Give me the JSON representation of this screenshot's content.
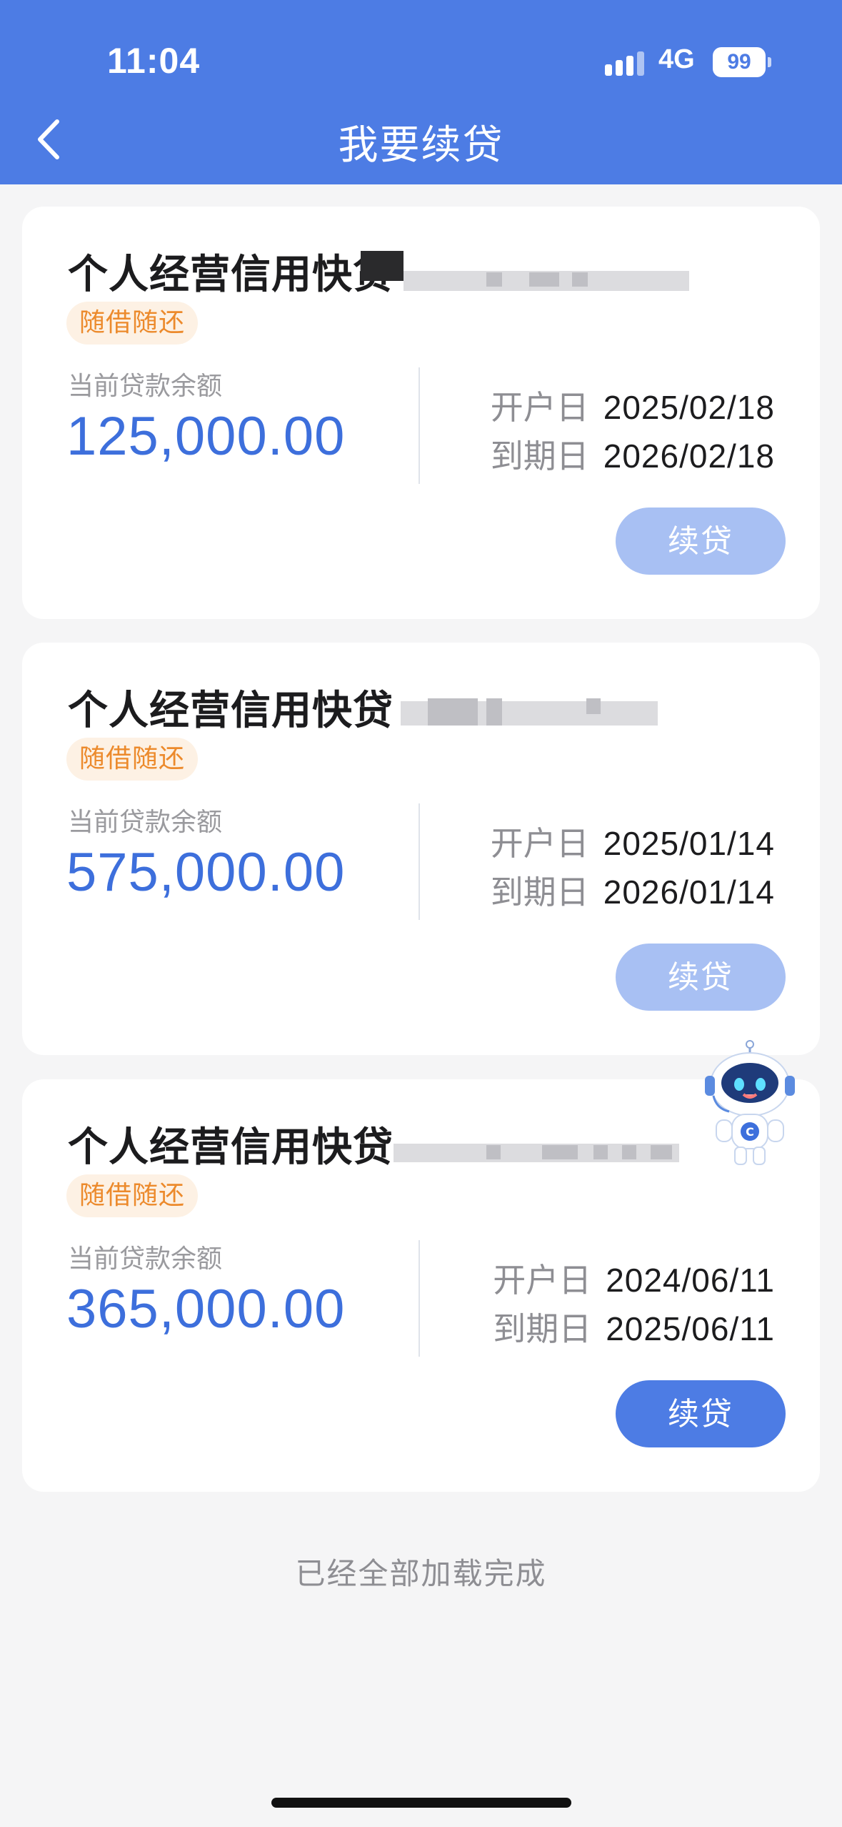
{
  "status_bar": {
    "time": "11:04",
    "network": "4G",
    "battery": "99"
  },
  "header": {
    "title": "我要续贷",
    "back_icon": "chevron-left-icon"
  },
  "loans": [
    {
      "title": "个人经营信用快贷",
      "tag": "随借随还",
      "balance_label": "当前贷款余额",
      "balance": "125,000.00",
      "open_label": "开户日",
      "open_date": "2025/02/18",
      "due_label": "到期日",
      "due_date": "2026/02/18",
      "button": "续贷",
      "button_enabled": false
    },
    {
      "title": "个人经营信用快贷",
      "tag": "随借随还",
      "balance_label": "当前贷款余额",
      "balance": "575,000.00",
      "open_label": "开户日",
      "open_date": "2025/01/14",
      "due_label": "到期日",
      "due_date": "2026/01/14",
      "button": "续贷",
      "button_enabled": false
    },
    {
      "title": "个人经营信用快贷",
      "tag": "随借随还",
      "balance_label": "当前贷款余额",
      "balance": "365,000.00",
      "open_label": "开户日",
      "open_date": "2024/06/11",
      "due_label": "到期日",
      "due_date": "2025/06/11",
      "button": "续贷",
      "button_enabled": true
    }
  ],
  "footer": {
    "text": "已经全部加载完成"
  },
  "colors": {
    "primary": "#4d7ce4",
    "disabled_button": "#a8c0f3",
    "tag_text": "#ec8a2c",
    "amount": "#3d6fdc"
  }
}
